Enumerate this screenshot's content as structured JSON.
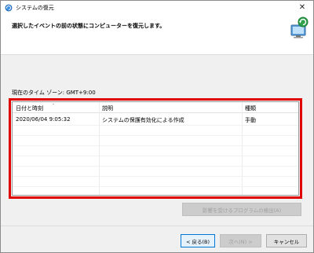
{
  "window": {
    "title": "システムの復元",
    "close_glyph": "✕"
  },
  "header": {
    "instruction": "選択したイベントの前の状態にコンピューターを復元します。"
  },
  "timezone": {
    "label": "現在のタイム ゾーン: GMT+9:00"
  },
  "table": {
    "columns": [
      "日付と時刻",
      "説明",
      "種類"
    ],
    "rows": [
      {
        "datetime": "2020/06/04 9:05:32",
        "description": "システムの保護有効化による作成",
        "type": "手動"
      }
    ]
  },
  "buttons": {
    "scan_affected": "影響を受けるプログラムの検出(A)",
    "back": "< 戻る(B)",
    "next": "次へ(N) >",
    "cancel": "キャンセル"
  },
  "colors": {
    "highlight_border": "#e00000",
    "accent": "#0078d7"
  },
  "icons": {
    "title": "system-restore-icon",
    "header": "computer-restore-graphic"
  }
}
